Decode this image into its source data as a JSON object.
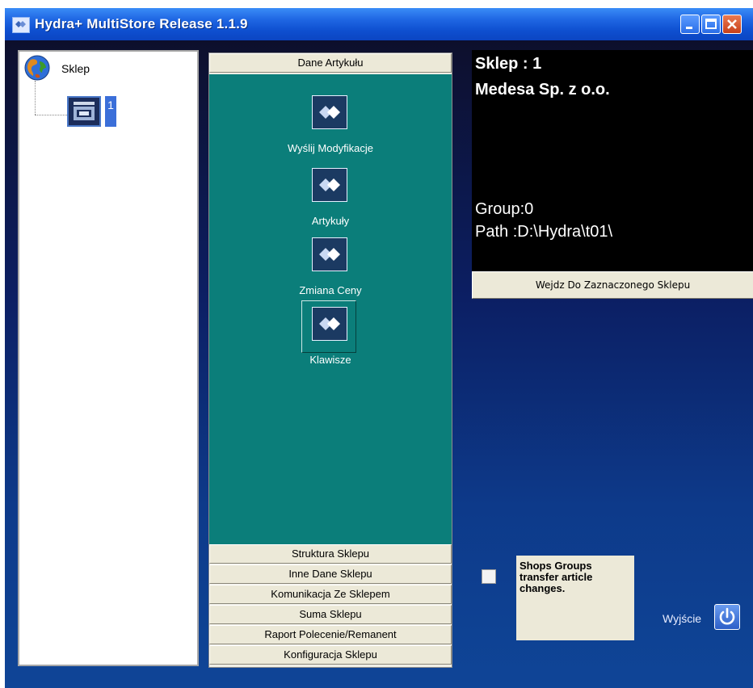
{
  "window": {
    "title": "Hydra+ MultiStore Release 1.1.9",
    "icons": [
      "app-icon",
      "minimize-icon",
      "maximize-icon",
      "close-icon"
    ]
  },
  "tree": {
    "root_label": "Sklep",
    "child_label": "1"
  },
  "outlook": {
    "header": "Dane Artykułu",
    "items": [
      {
        "label": "Wyślij Modyfikacje"
      },
      {
        "label": "Artykuły"
      },
      {
        "label": "Zmiana Ceny"
      },
      {
        "label": "Klawisze"
      }
    ],
    "sections": [
      "Struktura Sklepu",
      "Inne Dane Sklepu",
      "Komunikacja Ze Sklepem",
      "Suma Sklepu",
      "Raport Polecenie/Remanent",
      "Konfiguracja Sklepu"
    ]
  },
  "info": {
    "shop": "Sklep : 1",
    "company": "Medesa Sp. z o.o.",
    "group": "Group:0",
    "path": "Path :D:\\Hydra\\t01\\"
  },
  "enter_button": "Wejdz Do Zaznaczonego Sklepu",
  "checkbox_note": "Shops Groups transfer article changes.",
  "exit_label": "Wyjście",
  "colors": {
    "titlebar": "#1f67e3",
    "teal_panel": "#0b7e7a",
    "button_face": "#ece9d8",
    "client_bg": "#0c1f64"
  }
}
